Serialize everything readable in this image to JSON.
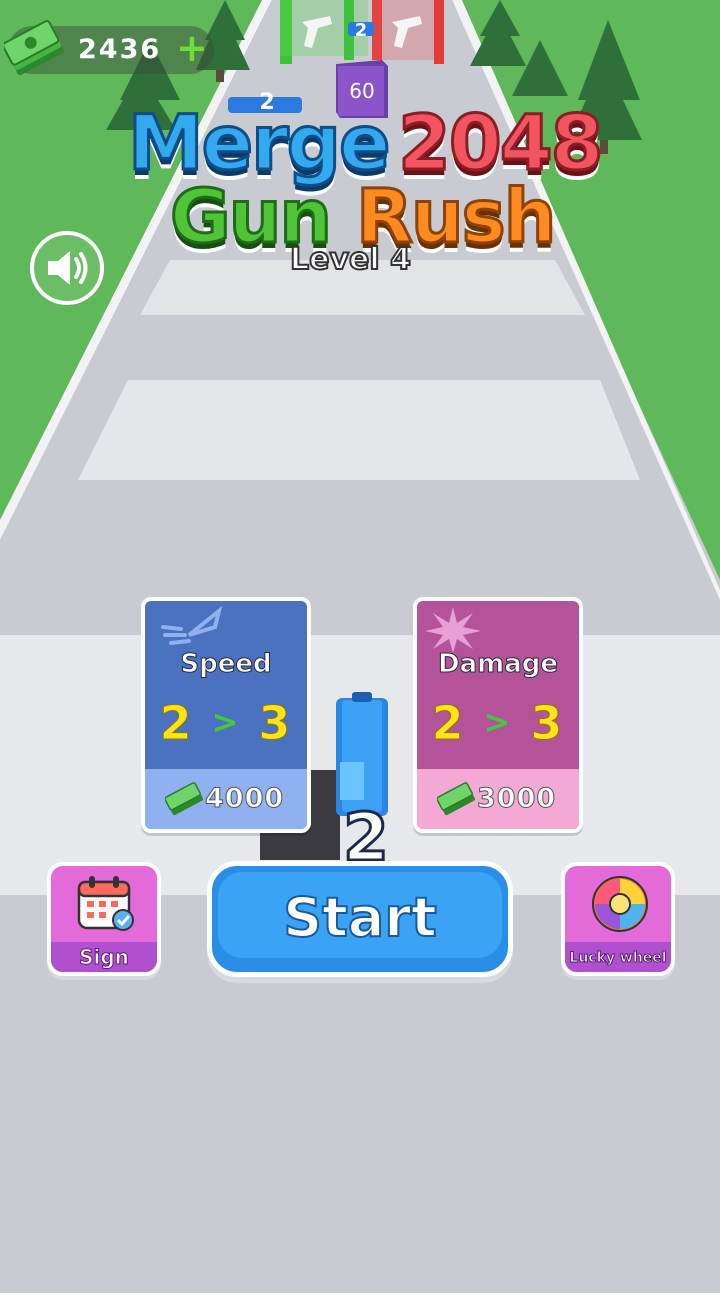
{
  "hud": {
    "currency": "2436",
    "add_symbol": "+"
  },
  "title": {
    "line1_a": "Merge",
    "line1_b": "2048",
    "line2_a": "Gun",
    "line2_b": "Rush",
    "level": "Level 4"
  },
  "scene": {
    "gate_left_value": "2",
    "block_value": "60",
    "carried_gun_value": "2",
    "player_gun_value": "2"
  },
  "upgrades": [
    {
      "title": "Speed",
      "from": "2",
      "arrow": ">",
      "to": "3",
      "price": "4000"
    },
    {
      "title": "Damage",
      "from": "2",
      "arrow": ">",
      "to": "3",
      "price": "3000"
    }
  ],
  "buttons": {
    "start": "Start",
    "sign": "Sign",
    "lucky_wheel": "Lucky wheel"
  },
  "colors": {
    "grass": "#5fb85a",
    "road": "#c9cbd3",
    "speed_card": "#4a72c0",
    "damage_card": "#b4529a",
    "start_button": "#3aa3f4",
    "side_button": "#e26bd9"
  }
}
